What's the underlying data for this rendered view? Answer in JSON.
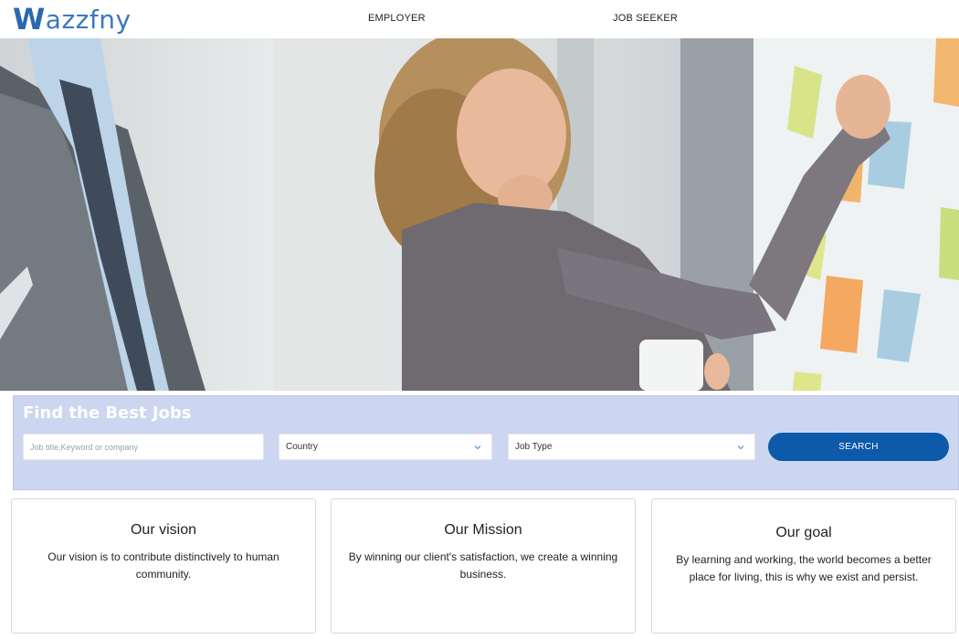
{
  "brand": {
    "logo_first": "W",
    "logo_rest": "azzfny",
    "color": "#2f6fb5"
  },
  "nav": {
    "employer": "EMPLOYER",
    "job_seeker": "JOB SEEKER"
  },
  "search": {
    "title": "Find the Best Jobs",
    "keyword_placeholder": "Job title,Keyword or company",
    "country_value": "Country",
    "job_type_value": "Job Type",
    "button_label": "SEARCH",
    "panel_color": "#cdd6f0",
    "button_color": "#0d59aa"
  },
  "cards": [
    {
      "title": "Our vision",
      "text": "Our vision is to contribute distinctively to human community."
    },
    {
      "title": "Our Mission",
      "text": "By winning our client's satisfaction, we create a winning business."
    },
    {
      "title": "Our goal",
      "text": "By learning and working, the world becomes a better place for living, this is why we exist and persist."
    }
  ],
  "icons": {
    "select_chevron": "chevron-down-icon"
  }
}
